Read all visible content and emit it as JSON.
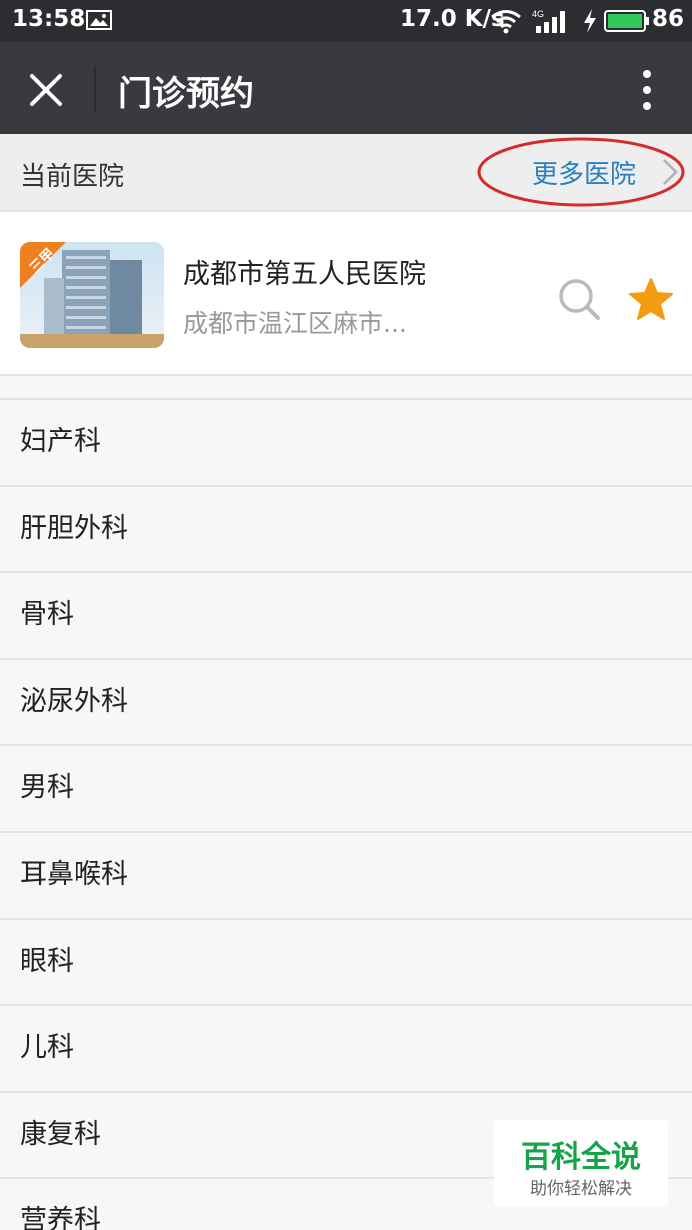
{
  "status_bar": {
    "time": "13:58",
    "speed": "17.0 K/s",
    "network": "4G",
    "battery_level": "86",
    "battery_color": "#34c759"
  },
  "nav": {
    "close_icon": "close-icon",
    "title": "门诊预约",
    "more_icon": "more-vertical-icon"
  },
  "hospital_header": {
    "label": "当前医院",
    "more_label": "更多医院",
    "annotation_color": "#d62b2b",
    "link_color": "#2a7fbf"
  },
  "hospital": {
    "grade_badge": "三甲",
    "name": "成都市第五人民医院",
    "address": "成都市温江区麻市...",
    "search_icon": "search-icon",
    "favorite_icon": "star-icon",
    "favorite_color": "#f39c12"
  },
  "departments": [
    "妇产科",
    "肝胆外科",
    "骨科",
    "泌尿外科",
    "男科",
    "耳鼻喉科",
    "眼科",
    "儿科",
    "康复科",
    "营养科"
  ],
  "watermark": {
    "title": "百科全说",
    "subtitle": "助你轻松解决",
    "color": "#16a34a"
  }
}
